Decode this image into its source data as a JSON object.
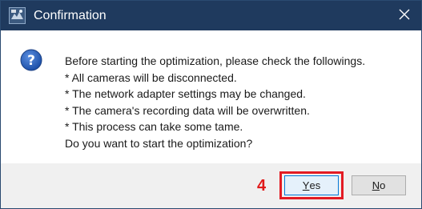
{
  "window": {
    "title": "Confirmation",
    "app_icon": "camera-app-icon",
    "close_icon": "close-icon",
    "titlebar_color": "#1f3a5e"
  },
  "message": {
    "icon": "question-icon",
    "lines": [
      "Before starting the optimization, please check the followings.",
      "* All cameras will be disconnected.",
      "* The network adapter settings may be changed.",
      "* The camera's recording data will be overwritten.",
      "* This process can take some tame.",
      "Do you want to start the optimization?"
    ]
  },
  "buttons": {
    "yes": {
      "accel": "Y",
      "rest": "es"
    },
    "no": {
      "accel": "N",
      "rest": "o"
    }
  },
  "annotation": {
    "step_number": "4",
    "color": "#e31b23"
  }
}
